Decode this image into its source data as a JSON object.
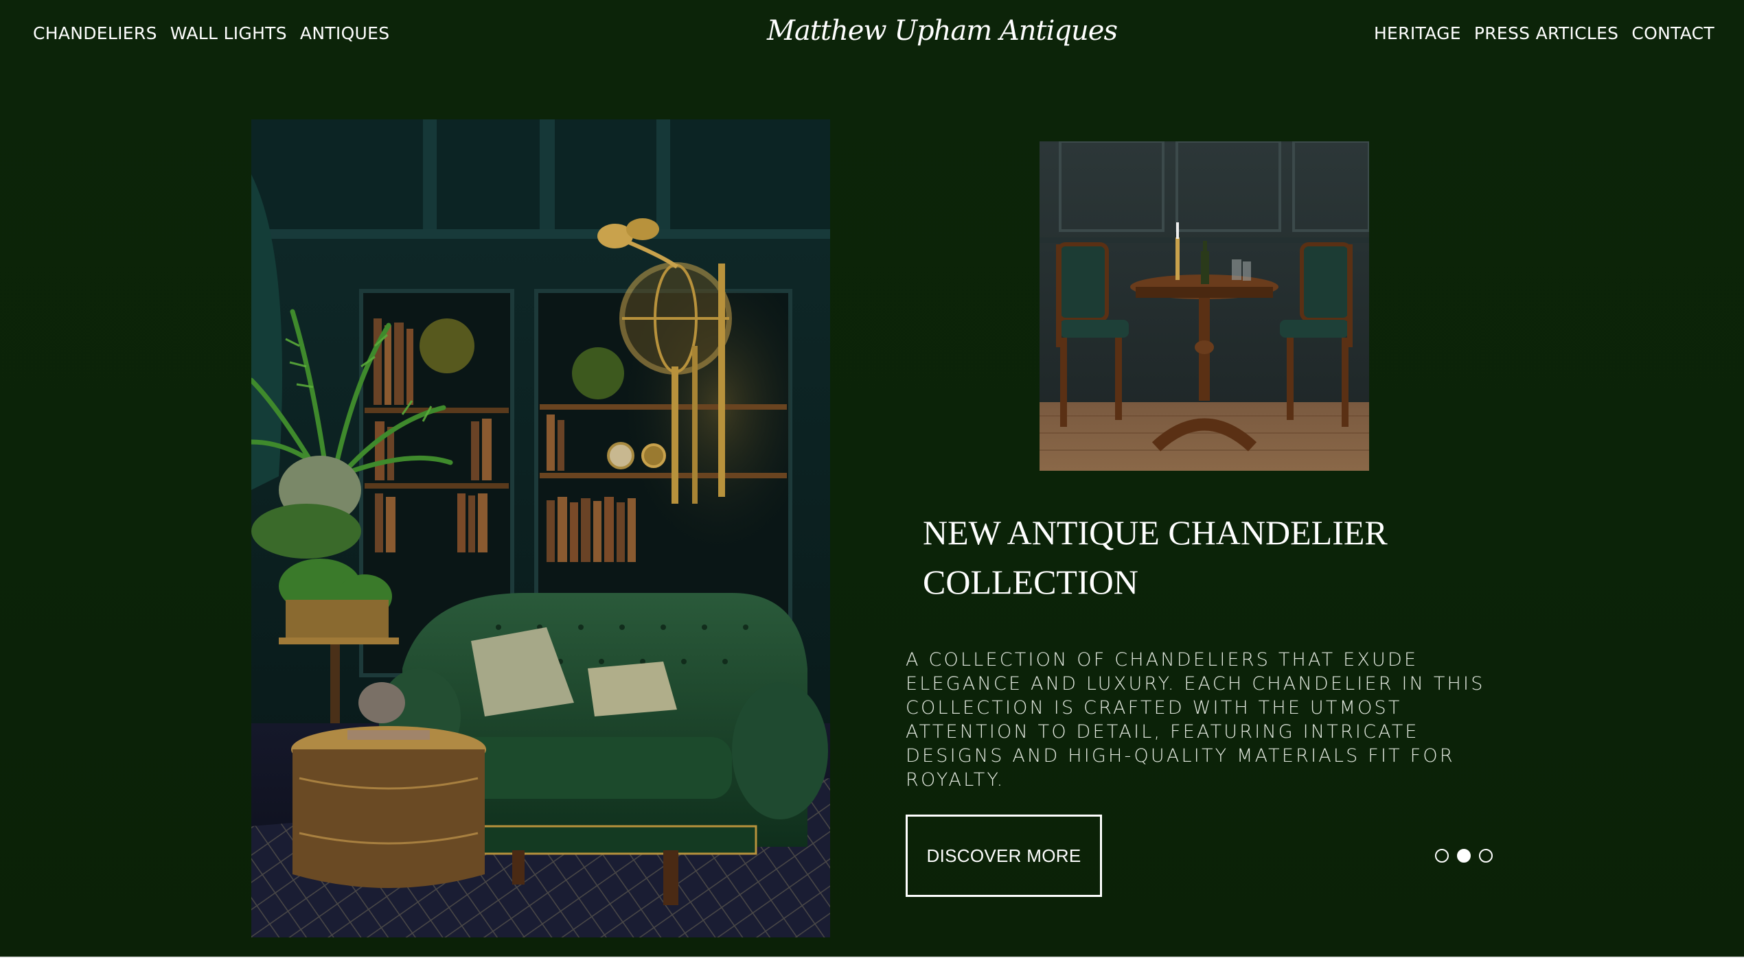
{
  "header": {
    "logo": "Matthew Upham Antiques",
    "nav_left": [
      "CHANDELIERS",
      "WALL LIGHTS",
      "ANTIQUES"
    ],
    "nav_right": [
      "HERITAGE",
      "PRESS ARTICLES",
      "CONTACT"
    ]
  },
  "hero": {
    "headline": "NEW ANTIQUE CHANDELIER COLLECTION",
    "description": "A COLLECTION OF CHANDELIERS THAT EXUDE ELEGANCE AND LUXURY. EACH CHANDELIER IN THIS COLLECTION IS CRAFTED WITH THE UTMOST ATTENTION TO DETAIL, FEATURING INTRICATE DESIGNS AND HIGH-QUALITY MATERIALS FIT FOR ROYALTY.",
    "cta_label": "DISCOVER MORE",
    "slides_total": 3,
    "active_slide": 2
  },
  "images": {
    "hero_image": "library-room-with-green-velvet-sofa-and-brass-globe-lamp",
    "side_image": "antique-bistro-table-with-two-leather-chairs"
  },
  "colors": {
    "background": "#0b2208",
    "text": "#ffffff",
    "button_border": "#ffffff"
  }
}
